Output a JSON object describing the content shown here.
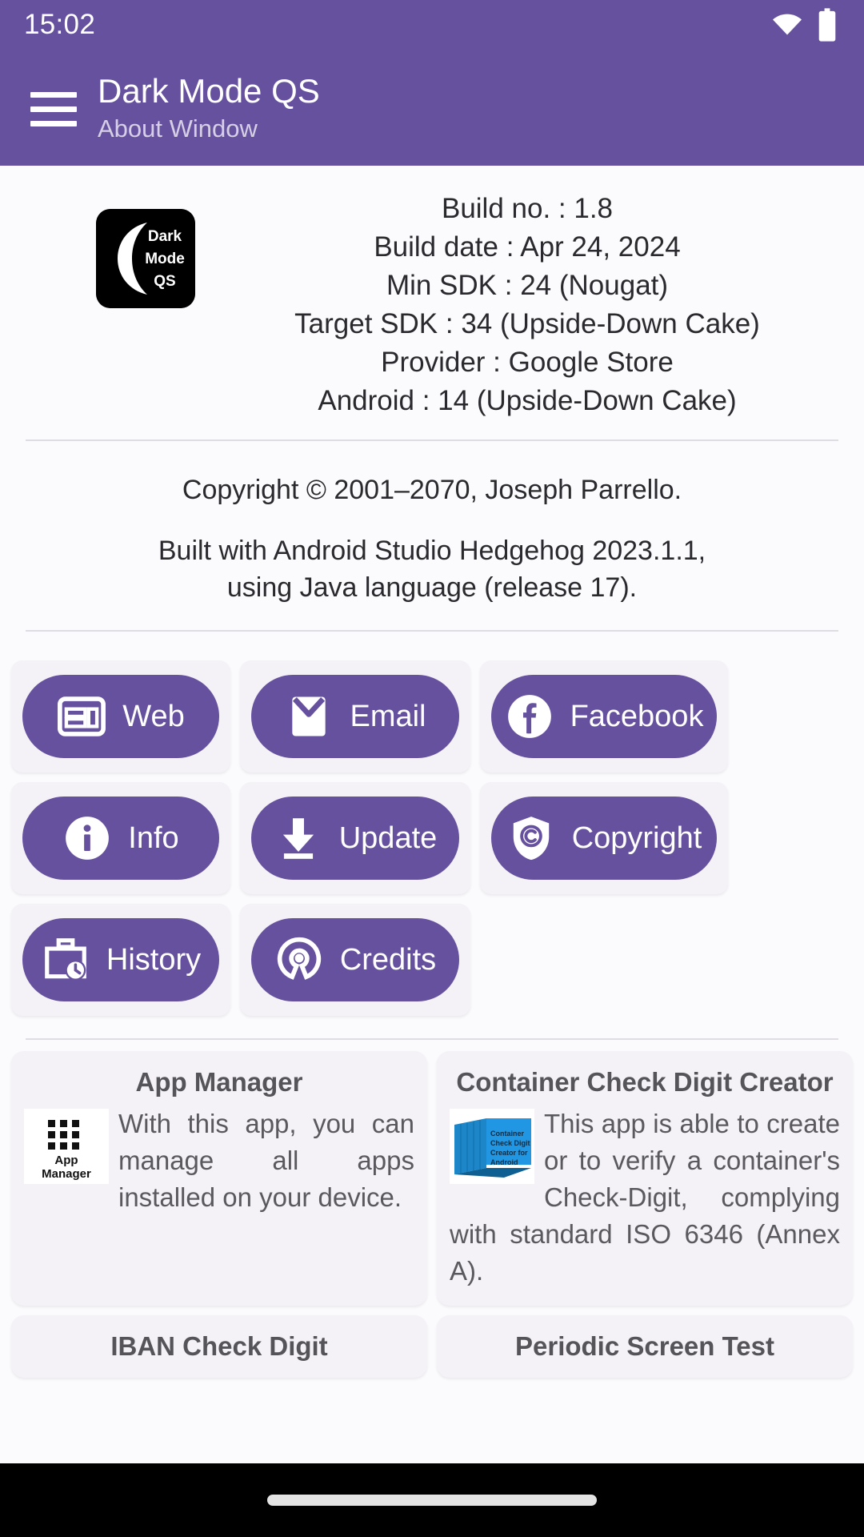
{
  "status_bar": {
    "time": "15:02",
    "icons": [
      "wifi-icon",
      "battery-icon"
    ]
  },
  "app_bar": {
    "menu_icon": "hamburger-menu-icon",
    "title": "Dark Mode QS",
    "subtitle": "About Window"
  },
  "app_icon": {
    "name": "dark-mode-qs-app-icon",
    "lines": [
      "Dark",
      "Mode",
      "QS"
    ]
  },
  "build_info": [
    {
      "label": "Build no. :",
      "value": "1.8"
    },
    {
      "label": "Build date :",
      "value": "Apr 24, 2024"
    },
    {
      "label": "Min SDK :",
      "value": "24 (Nougat)"
    },
    {
      "label": "Target SDK :",
      "value": "34 (Upside-Down Cake)"
    },
    {
      "label": "Provider :",
      "value": "Google Store"
    },
    {
      "label": "Android :",
      "value": "14 (Upside-Down Cake)"
    }
  ],
  "copyright": {
    "line1": "Copyright © 2001–2070, Joseph Parrello.",
    "line2": "Built with Android Studio Hedgehog 2023.1.1,",
    "line3": "using Java language (release 17)."
  },
  "buttons": {
    "row1": [
      {
        "label": "Web",
        "icon": "web-page-layout-icon"
      },
      {
        "label": "Email",
        "icon": "envelope-icon"
      },
      {
        "label": "Facebook",
        "icon": "facebook-icon"
      }
    ],
    "row2": [
      {
        "label": "Info",
        "icon": "info-circle-icon"
      },
      {
        "label": "Update",
        "icon": "download-arrow-icon"
      },
      {
        "label": "Copyright",
        "icon": "copyright-shield-icon"
      }
    ],
    "row3": [
      {
        "label": "History",
        "icon": "work-history-briefcase-clock-icon"
      },
      {
        "label": "Credits",
        "icon": "open-source-initiative-icon"
      }
    ]
  },
  "app_cards": [
    {
      "title": "App Manager",
      "icon": "app-manager-grid-icon",
      "icon_caption_line1": "App",
      "icon_caption_line2": "Manager",
      "description": "With this app, you can manage all apps installed on your device."
    },
    {
      "title": "Container Check Digit Creator",
      "icon": "container-check-digit-icon",
      "icon_caption_line1": "Container",
      "icon_caption_line2": "Check Digit",
      "icon_caption_line3": "Creator for",
      "icon_caption_line4": "Android",
      "description": "This app is able to create or to verify a container's Check-Digit, complying with standard ISO 6346 (Annex A)."
    }
  ],
  "app_cards_clipped": [
    {
      "title": "IBAN Check Digit"
    },
    {
      "title": "Periodic Screen Test"
    }
  ],
  "nav_bar": {
    "gesture_pill": "home-gesture-pill"
  },
  "colors": {
    "primary_purple": "#66519F",
    "page_background": "#FBFAFD",
    "card_background": "#F4F1F7",
    "divider": "#DFDCE3",
    "text_primary": "#2A2A2E",
    "text_secondary": "#5A5A5E",
    "nav_bar": "#000000"
  }
}
